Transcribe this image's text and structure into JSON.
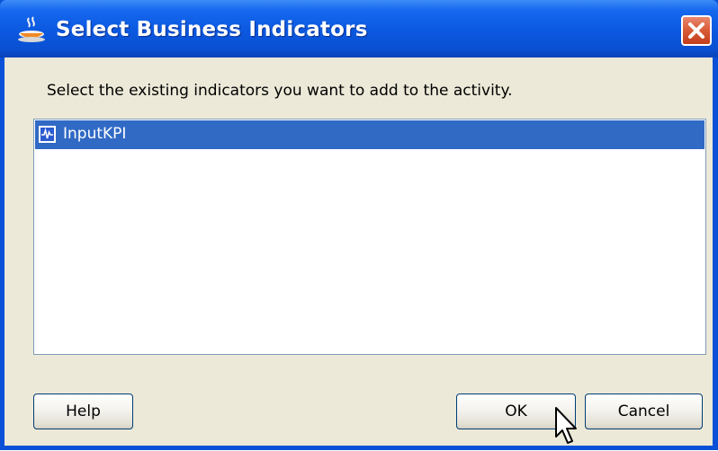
{
  "window": {
    "title": "Select Business Indicators",
    "title_icon": "oracle-jdeveloper-cup-icon",
    "close_icon": "close-icon"
  },
  "dialog": {
    "instruction": "Select the existing indicators you want to add to the activity.",
    "indicators": [
      {
        "label": "InputKPI",
        "icon": "kpi-indicator-icon",
        "selected": true
      }
    ]
  },
  "buttons": {
    "help": "Help",
    "ok": "OK",
    "cancel": "Cancel"
  },
  "colors": {
    "titlebar": "#0a56dc",
    "dialog_bg": "#ece9d8",
    "selection": "#316ac5",
    "close_button": "#d85a36"
  }
}
